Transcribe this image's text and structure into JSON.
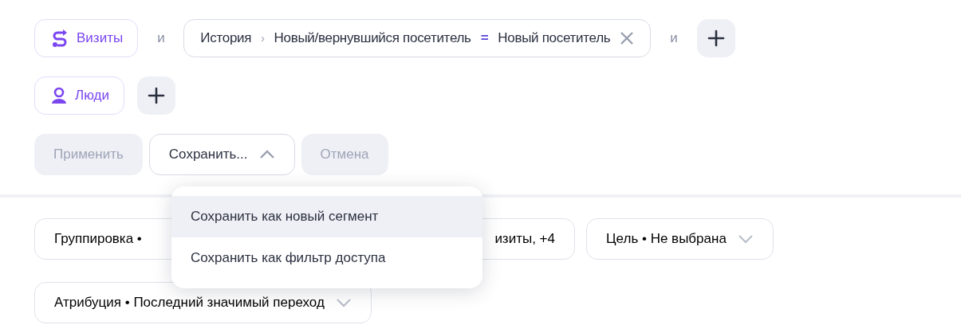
{
  "segments": [
    {
      "kind": "visits",
      "label": "Визиты",
      "joiner": "и",
      "conditions": [
        {
          "path": "История",
          "separator": "›",
          "field": "Новый/вернувшийся посетитель",
          "operator": "=",
          "value": "Новый посетитель"
        }
      ],
      "trailing_joiner": "и"
    },
    {
      "kind": "people",
      "label": "Люди"
    }
  ],
  "actions": [
    {
      "label": "Применить",
      "disabled": true,
      "kind": "button"
    },
    {
      "label": "Сохранить...",
      "disabled": false,
      "kind": "dropdown",
      "expanded": true
    },
    {
      "label": "Отмена",
      "disabled": true,
      "kind": "button"
    }
  ],
  "save_menu": [
    {
      "label": "Сохранить как новый сегмент",
      "selected": true
    },
    {
      "label": "Сохранить как фильтр доступа",
      "selected": false
    }
  ],
  "report_settings": [
    {
      "label": "Группировка •",
      "kind": "covered_end"
    },
    {
      "label": "изиты, +4",
      "kind": "covered_start"
    },
    {
      "label": "Цель • Не выбрана",
      "kind": "select"
    },
    {
      "label": "Атрибуция • Последний значимый переход",
      "kind": "select"
    }
  ]
}
